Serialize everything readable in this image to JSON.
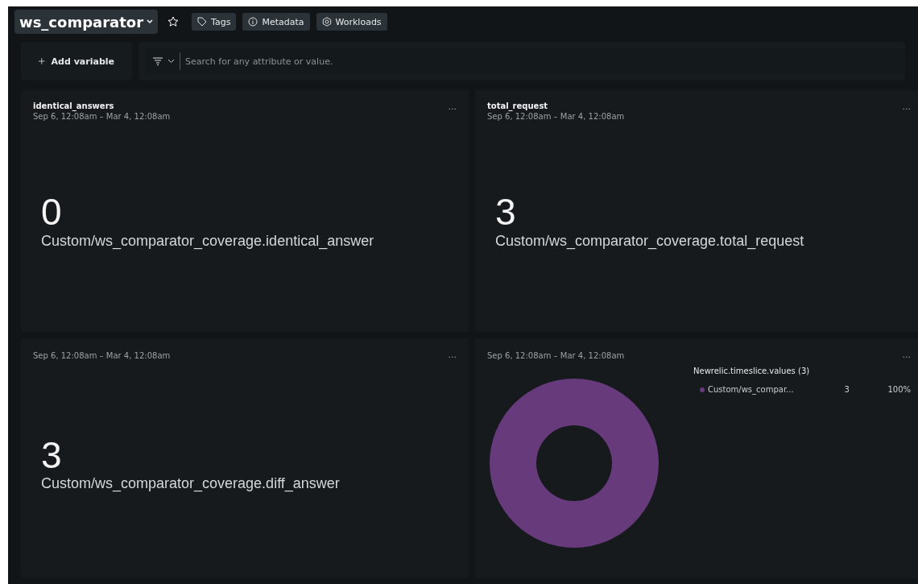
{
  "header": {
    "title": "ws_comparator",
    "favorite": false,
    "buttons": [
      {
        "kind": "tag",
        "label": "Tags"
      },
      {
        "kind": "info",
        "label": "Metadata"
      },
      {
        "kind": "hex",
        "label": "Workloads"
      }
    ]
  },
  "filter_bar": {
    "add_variable": "Add variable",
    "search": {
      "placeholder": "Search for any attribute or value."
    }
  },
  "widgets": [
    {
      "kind": "billboard",
      "title": "identical_answers",
      "time_range": "Sep 6, 12:08am – Mar 4, 12:08am",
      "value": "0",
      "metric": "Custom/ws_comparator_coverage.identical_answer"
    },
    {
      "kind": "billboard",
      "title": "total_request",
      "time_range": "Sep 6, 12:08am – Mar 4, 12:08am",
      "value": "3",
      "metric": "Custom/ws_comparator_coverage.total_request"
    },
    {
      "kind": "billboard",
      "time_range": "Sep 6, 12:08am – Mar 4, 12:08am",
      "value": "3",
      "metric": "Custom/ws_comparator_coverage.diff_answer"
    },
    {
      "kind": "donut",
      "time_range": "Sep 6, 12:08am – Mar 4, 12:08am",
      "legend_title": "Newrelic.timeslice.values (3)",
      "legend": [
        {
          "label": "Custom/ws_compar...",
          "count": "3",
          "percent": "100%",
          "color": "#673b7b"
        }
      ]
    }
  ],
  "more_label": "..."
}
